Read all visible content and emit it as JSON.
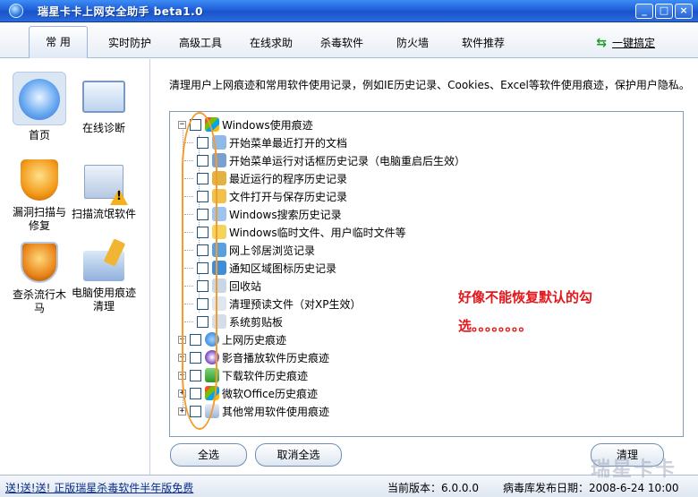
{
  "window": {
    "title": "瑞星卡卡上网安全助手 beta1.0",
    "controls": [
      "_",
      "□",
      "×"
    ]
  },
  "menu": {
    "items": [
      "常 用",
      "实时防护",
      "高级工具",
      "在线求助",
      "杀毒软件",
      "防火墙",
      "软件推荐"
    ],
    "one_key": "一键搞定"
  },
  "sidebar": {
    "items": [
      {
        "label": "首页",
        "icon": "home-icon"
      },
      {
        "label": "在线诊断",
        "icon": "diagnose-icon"
      },
      {
        "label": "漏洞扫描与修复",
        "icon": "shield-scan-icon"
      },
      {
        "label": "扫描流氓软件",
        "icon": "malware-scan-icon"
      },
      {
        "label": "查杀流行木马",
        "icon": "trojan-kill-icon"
      },
      {
        "label": "电脑使用痕迹清理",
        "icon": "broom-clean-icon"
      }
    ]
  },
  "content": {
    "description": "清理用户上网痕迹和常用软件使用记录，例如IE历史记录、Cookies、Excel等软件使用痕迹，保护用户隐私。",
    "tree": {
      "root": {
        "label": "Windows使用痕迹",
        "expand": "−"
      },
      "children": [
        "开始菜单最近打开的文档",
        "开始菜单运行对话框历史记录（电脑重启后生效）",
        "最近运行的程序历史记录",
        "文件打开与保存历史记录",
        "Windows搜索历史记录",
        "Windows临时文件、用户临时文件等",
        "网上邻居浏览记录",
        "通知区域图标历史记录",
        "回收站",
        "清理预读文件（对XP生效）",
        "系统剪贴板"
      ],
      "groups": [
        {
          "label": "上网历史痕迹",
          "expand": "+"
        },
        {
          "label": "影音播放软件历史痕迹",
          "expand": "+"
        },
        {
          "label": "下载软件历史痕迹",
          "expand": "+"
        },
        {
          "label": "微软Office历史痕迹",
          "expand": "+"
        },
        {
          "label": "其他常用软件使用痕迹",
          "expand": "+"
        }
      ]
    },
    "annotation": "好像不能恢复默认的勾选。。。。。。。。",
    "buttons": {
      "select_all": "全选",
      "deselect_all": "取消全选",
      "clean": "清理"
    }
  },
  "status": {
    "promo": "送!送!送! 正版瑞星杀毒软件半年版免费",
    "version": "当前版本：6.0.0.0",
    "db_date": "病毒库发布日期：2008-6-24 10:00",
    "watermark": "瑞星卡卡"
  },
  "colors": {
    "titlebar": "#1f5fd8",
    "annotation_red": "#e3181c",
    "annotation_circle": "#f39b2c"
  }
}
